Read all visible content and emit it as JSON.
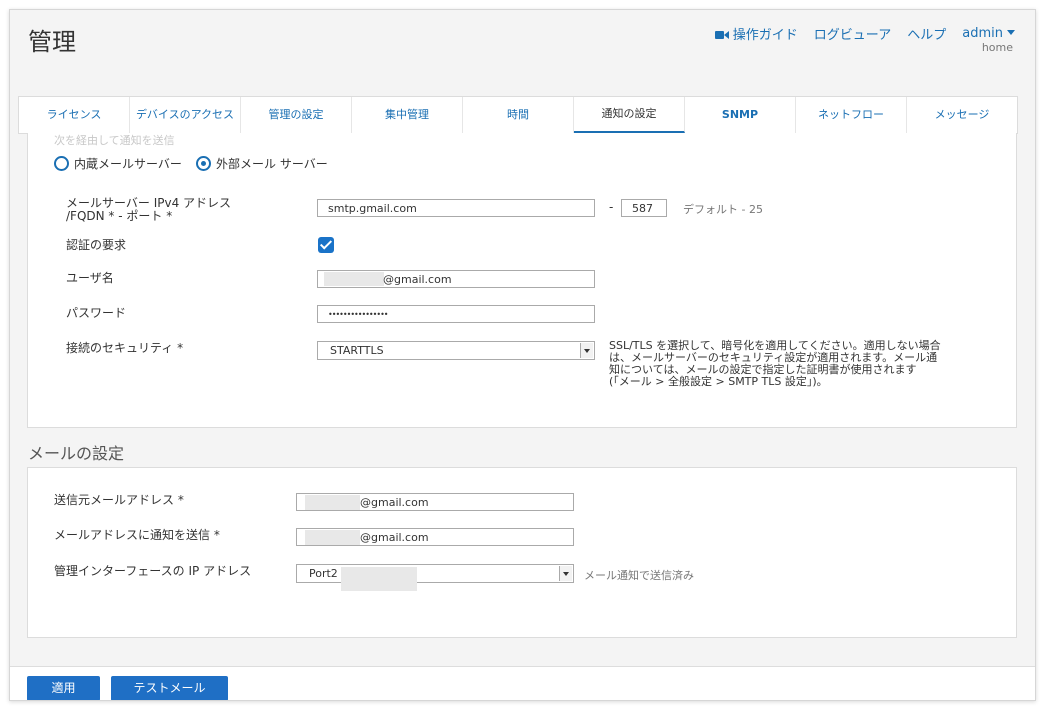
{
  "header": {
    "title": "管理",
    "nav": {
      "guide": "操作ガイド",
      "log_viewer": "ログビューア",
      "help": "ヘルプ",
      "user": "admin"
    },
    "location": "home"
  },
  "tabs": [
    {
      "label": "ライセンス",
      "active": false
    },
    {
      "label": "デバイスのアクセス",
      "active": false
    },
    {
      "label": "管理の設定",
      "active": false
    },
    {
      "label": "集中管理",
      "active": false
    },
    {
      "label": "時間",
      "active": false
    },
    {
      "label": "通知の設定",
      "active": true
    },
    {
      "label": "SNMP",
      "active": false
    },
    {
      "label": "ネットフロー",
      "active": false
    },
    {
      "label": "メッセージ",
      "active": false
    }
  ],
  "server_panel": {
    "faded_label": "次を経由して通知を送信",
    "radio_internal": "内蔵メールサーバー",
    "radio_external": "外部メール サーバー",
    "selected": "外部メール サーバー",
    "server_label_line1": "メールサーバー IPv4 アドレス",
    "server_label_line2": "/FQDN * - ポート *",
    "server_value": "smtp.gmail.com",
    "port_sep": "-",
    "port_value": "587",
    "port_default": "デフォルト - 25",
    "auth_label": "認証の要求",
    "auth_checked": true,
    "username_label": "ユーザ名",
    "username_value": "@gmail.com",
    "password_label": "パスワード",
    "password_value": "••••••••••••••••",
    "security_label": "接続のセキュリティ *",
    "security_value": "STARTTLS",
    "security_note": [
      "SSL/TLS を選択して、暗号化を適用してください。適用しない場合",
      "は、メールサーバーのセキュリティ設定が適用されます。メール通",
      "知については、メールの設定で指定した証明書が使用されます",
      "(「メール > 全般設定 > SMTP TLS 設定」)。"
    ]
  },
  "mail_settings": {
    "title": "メールの設定",
    "sender_label": "送信元メールアドレス *",
    "sender_value": "@gmail.com",
    "recipient_label": "メールアドレスに通知を送信 *",
    "recipient_value": "@gmail.com",
    "ip_label": "管理インターフェースの IP アドレス",
    "ip_value": "Port2",
    "ip_note": "メール通知で送信済み"
  },
  "footer": {
    "apply": "適用",
    "test_mail": "テストメール"
  },
  "colors": {
    "accent": "#1a6fb3",
    "button": "#1f6fc5"
  }
}
